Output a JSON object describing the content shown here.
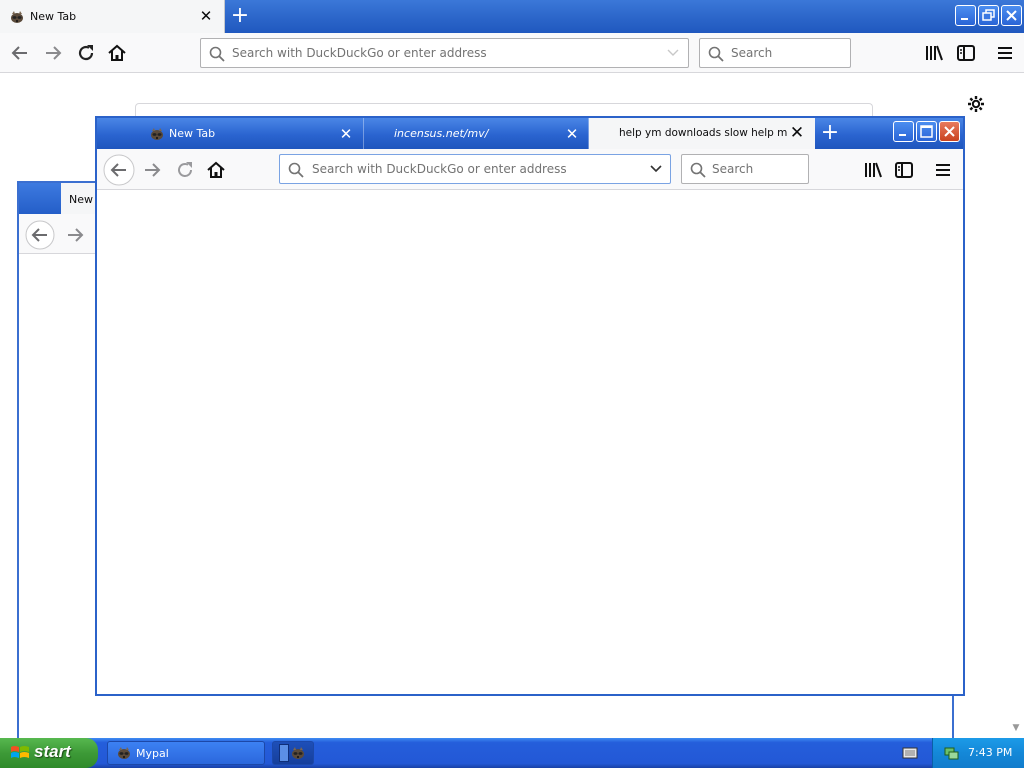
{
  "background_browser": {
    "tab_label": "New Tab",
    "url_placeholder": "Search with DuckDuckGo or enter address",
    "search_placeholder": "Search"
  },
  "middle_browser": {
    "tab_label": "New T"
  },
  "front_browser": {
    "tabs": [
      {
        "label": "New Tab",
        "active": false
      },
      {
        "label": "incensus.net/mv/",
        "active": false
      },
      {
        "label": "help ym downloads slow help me im",
        "active": true
      }
    ],
    "url_placeholder": "Search with DuckDuckGo or enter address",
    "search_placeholder": "Search"
  },
  "taskbar": {
    "start_label": "start",
    "items": [
      {
        "label": "Mypal"
      },
      {
        "label": ""
      }
    ],
    "clock": "7:43 PM"
  },
  "colors": {
    "xp_blue": "#245edb",
    "start_green": "#3d9a37",
    "tray_blue": "#1488d8"
  },
  "icons": {
    "favicon": "mypal-raccoon-icon",
    "back": "back-arrow-icon",
    "forward": "forward-arrow-icon",
    "reload": "reload-icon",
    "home": "home-icon",
    "library": "library-icon",
    "sidebar": "sidebar-icon",
    "menu": "hamburger-menu-icon"
  }
}
